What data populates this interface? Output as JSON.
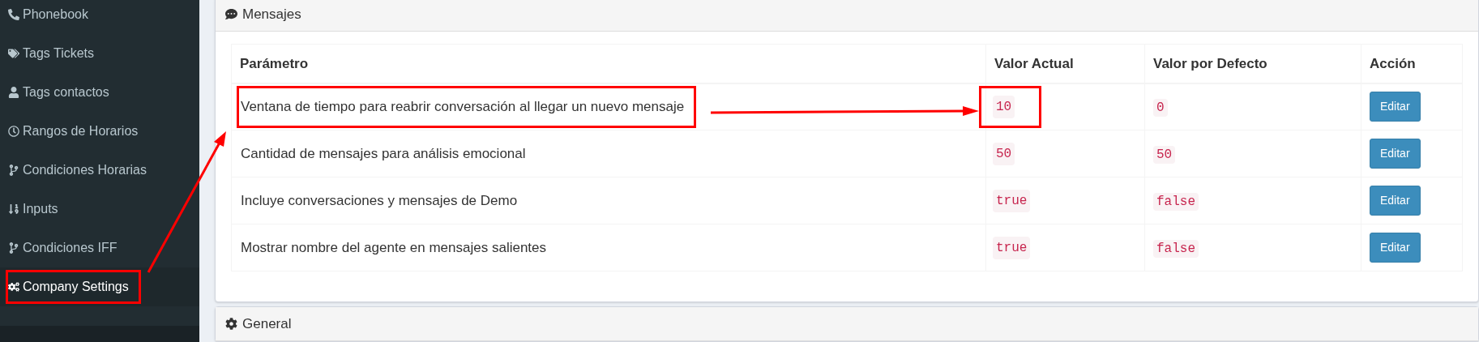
{
  "sidebar": {
    "items": [
      {
        "label": "Phonebook",
        "selected": false,
        "highlighted": false
      },
      {
        "label": "Tags Tickets",
        "selected": false,
        "highlighted": false
      },
      {
        "label": "Tags contactos",
        "selected": false,
        "highlighted": false
      },
      {
        "label": "Rangos de Horarios",
        "selected": false,
        "highlighted": false
      },
      {
        "label": "Condiciones Horarias",
        "selected": false,
        "highlighted": false
      },
      {
        "label": "Inputs",
        "selected": false,
        "highlighted": false
      },
      {
        "label": "Condiciones IFF",
        "selected": false,
        "highlighted": false
      },
      {
        "label": "Company Settings",
        "selected": true,
        "highlighted": true
      }
    ]
  },
  "panels": [
    {
      "title": "Mensajes",
      "table": {
        "columns": [
          "Parámetro",
          "Valor Actual",
          "Valor por Defecto",
          "Acción"
        ],
        "rows": [
          {
            "parameter": {
              "text": "Ventana de tiempo para reabrir conversación al llegar un nuevo mensaje",
              "highlighted": true
            },
            "current": {
              "value": "10",
              "highlighted": true
            },
            "default": "0",
            "action": "Editar"
          },
          {
            "parameter": {
              "text": "Cantidad de mensajes para análisis emocional",
              "highlighted": false
            },
            "current": {
              "value": "50",
              "highlighted": false
            },
            "default": "50",
            "action": "Editar"
          },
          {
            "parameter": {
              "text": "Incluye conversaciones y mensajes de Demo",
              "highlighted": false
            },
            "current": {
              "value": "true",
              "highlighted": false
            },
            "default": "false",
            "action": "Editar"
          },
          {
            "parameter": {
              "text": "Mostrar nombre del agente en mensajes salientes",
              "highlighted": false
            },
            "current": {
              "value": "true",
              "highlighted": false
            },
            "default": "false",
            "action": "Editar"
          }
        ]
      }
    },
    {
      "title": "General"
    }
  ]
}
